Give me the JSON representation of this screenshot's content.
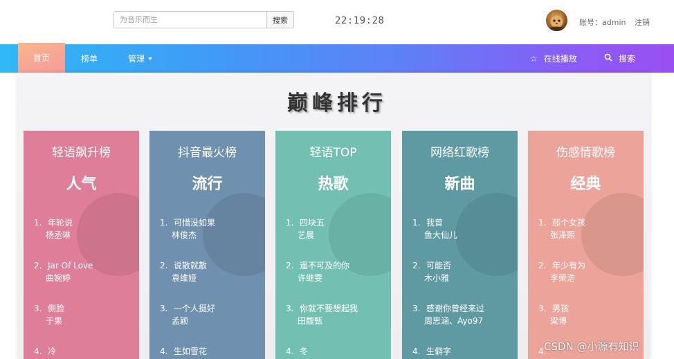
{
  "topbar": {
    "search_placeholder": "为音乐而生",
    "search_button": "搜索",
    "clock": "22:19:28",
    "account_label": "账号：admin",
    "logout_label": "注销"
  },
  "nav": {
    "home": "首页",
    "ranking": "榜单",
    "manage": "管理",
    "online_play": "在线播放",
    "search": "搜索"
  },
  "page": {
    "heading": "巅峰排行"
  },
  "cards": [
    {
      "title": "轻语飙升榜",
      "tag": "人气",
      "color": "#df7e98",
      "songs": [
        {
          "num": "1.",
          "title": "年轮说",
          "artist": "杨丞琳"
        },
        {
          "num": "2.",
          "title": "Jar Of Love",
          "artist": "曲婉婷"
        },
        {
          "num": "3.",
          "title": "侧脸",
          "artist": "于果"
        },
        {
          "num": "4.",
          "title": "冷",
          "artist": ""
        }
      ]
    },
    {
      "title": "抖音最火榜",
      "tag": "流行",
      "color": "#6f90ae",
      "songs": [
        {
          "num": "1.",
          "title": "可惜没如果",
          "artist": "林俊杰"
        },
        {
          "num": "2.",
          "title": "说散就散",
          "artist": "袁维娅"
        },
        {
          "num": "3.",
          "title": "一个人挺好",
          "artist": "孟颖"
        },
        {
          "num": "4.",
          "title": "生如雪花",
          "artist": ""
        }
      ]
    },
    {
      "title": "轻语TOP",
      "tag": "热歌",
      "color": "#73c0b3",
      "songs": [
        {
          "num": "1.",
          "title": "四块五",
          "artist": "艺晨"
        },
        {
          "num": "2.",
          "title": "遥不可及的你",
          "artist": "许继雯"
        },
        {
          "num": "3.",
          "title": "你就不要想起我",
          "artist": "田馥甄"
        },
        {
          "num": "4.",
          "title": "冬",
          "artist": ""
        }
      ]
    },
    {
      "title": "网络红歌榜",
      "tag": "新曲",
      "color": "#5f9aa3",
      "songs": [
        {
          "num": "1.",
          "title": "我曾",
          "artist": "鱼大仙儿"
        },
        {
          "num": "2.",
          "title": "可能否",
          "artist": "木小雅"
        },
        {
          "num": "3.",
          "title": "感谢你曾经来过",
          "artist": "周思涵、Ayo97"
        },
        {
          "num": "4.",
          "title": "生僻字",
          "artist": ""
        }
      ]
    },
    {
      "title": "伤感情歌榜",
      "tag": "经典",
      "color": "#eba39a",
      "songs": [
        {
          "num": "1.",
          "title": "那个女孩",
          "artist": "张泽熙"
        },
        {
          "num": "2.",
          "title": "年少有为",
          "artist": "李荣浩"
        },
        {
          "num": "3.",
          "title": "男孩",
          "artist": "梁博"
        },
        {
          "num": "4.",
          "title": "",
          "artist": ""
        }
      ]
    }
  ],
  "watermark": "CSDN @小源有知识",
  "icons": {
    "online_play": "star-icon",
    "search": "search-icon"
  }
}
